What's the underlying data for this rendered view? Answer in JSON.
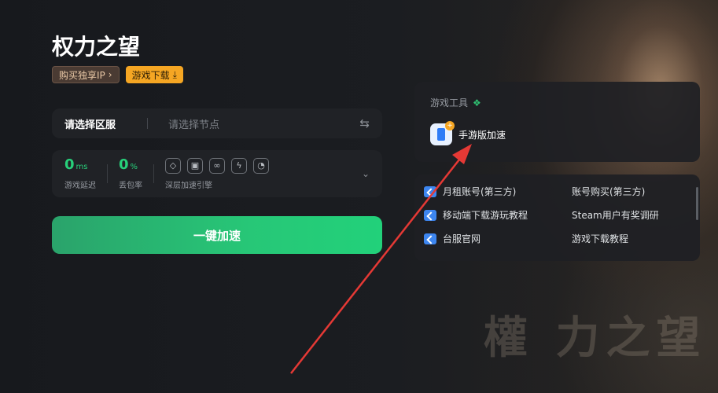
{
  "game": {
    "title": "权力之望",
    "tag_ip": "购买独享IP",
    "tag_download": "游戏下载"
  },
  "region": {
    "label": "请选择区服",
    "node_placeholder": "请选择节点"
  },
  "stats": {
    "latency_value": "0",
    "latency_unit": "ms",
    "latency_caption": "游戏延迟",
    "loss_value": "0",
    "loss_unit": "%",
    "loss_caption": "丢包率",
    "engine_caption": "深层加速引擎"
  },
  "accelerate_label": "一键加速",
  "tools": {
    "heading": "游戏工具",
    "mobile_label": "手游版加速"
  },
  "links": [
    {
      "label": "月租账号(第三方)",
      "icon": true
    },
    {
      "label": "账号购买(第三方)",
      "icon": false
    },
    {
      "label": "移动端下载游玩教程",
      "icon": true
    },
    {
      "label": "Steam用户有奖调研",
      "icon": false
    },
    {
      "label": "台服官网",
      "icon": true
    },
    {
      "label": "游戏下载教程",
      "icon": false
    }
  ],
  "background_logo": "權 力之望",
  "colors": {
    "accent_green": "#27d07a",
    "download_orange": "#f5a623",
    "annotation_arrow": "#e53935"
  }
}
